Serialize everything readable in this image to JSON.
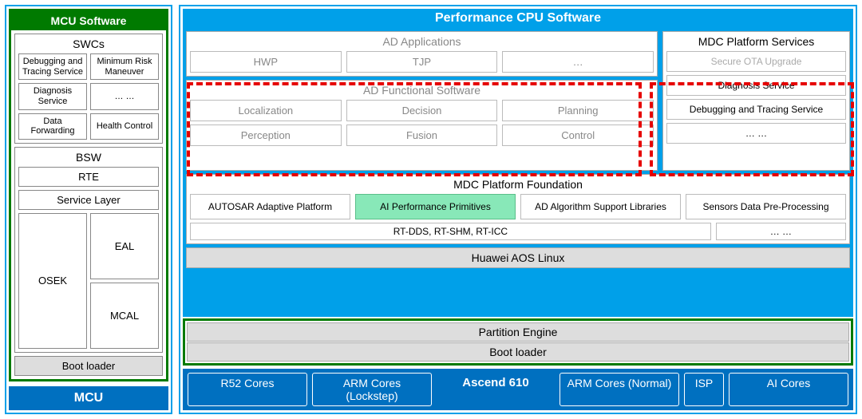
{
  "left": {
    "header": "MCU Software",
    "swcs": {
      "header": "SWCs",
      "items": [
        "Debugging and Tracing Service",
        "Minimum Risk Maneuver",
        "Diagnosis Service",
        "… …",
        "Data Forwarding",
        "Health Control"
      ]
    },
    "bsw": {
      "header": "BSW",
      "rte": "RTE",
      "service_layer": "Service Layer",
      "osek": "OSEK",
      "eal": "EAL",
      "mcal": "MCAL"
    },
    "bootloader": "Boot loader",
    "mcu": "MCU"
  },
  "right": {
    "header": "Performance CPU Software",
    "ad_apps": {
      "header": "AD Applications",
      "items": [
        "HWP",
        "TJP",
        "…"
      ]
    },
    "ad_func": {
      "header": "AD Functional Software",
      "row1": [
        "Localization",
        "Decision",
        "Planning"
      ],
      "row2": [
        "Perception",
        "Fusion",
        "Control"
      ]
    },
    "mdc_services": {
      "header": "MDC  Platform Services",
      "items": [
        "Secure OTA Upgrade",
        "Diagnosis Service",
        "Debugging and Tracing Service",
        "… …"
      ]
    },
    "mdc_foundation": {
      "header": "MDC  Platform Foundation",
      "cells": [
        "AUTOSAR Adaptive Platform",
        "AI Performance Primitives",
        "AD Algorithm Support Libraries",
        "Sensors Data Pre-Processing"
      ],
      "sub": [
        "RT-DDS, RT-SHM, RT-ICC",
        "… …"
      ]
    },
    "aos": "Huawei AOS Linux",
    "partition": "Partition Engine",
    "bootloader": "Boot loader",
    "cores": [
      "R52 Cores",
      "ARM Cores (Lockstep)",
      "Ascend 610",
      "ARM Cores (Normal)",
      "ISP",
      "AI Cores"
    ]
  }
}
